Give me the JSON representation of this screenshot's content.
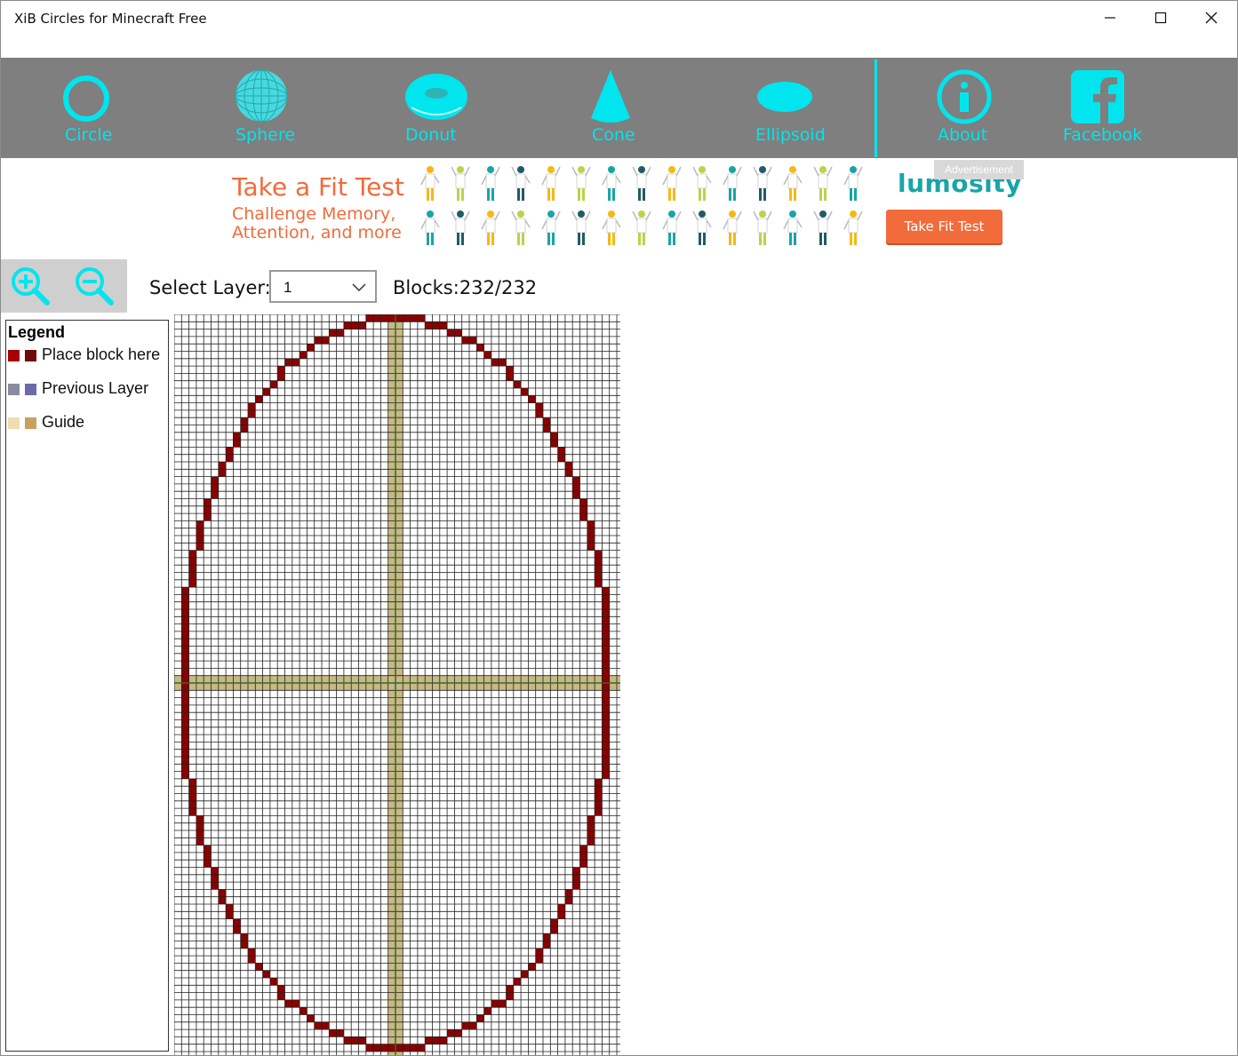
{
  "window": {
    "title": "XiB Circles for Minecraft Free",
    "controls": [
      "minimize",
      "maximize",
      "close"
    ]
  },
  "toolbar": {
    "background": "#7f7f7f",
    "accent": "#00e5ee",
    "items": [
      {
        "label": "Circle",
        "icon": "circle-icon"
      },
      {
        "label": "Sphere",
        "icon": "sphere-icon"
      },
      {
        "label": "Donut",
        "icon": "donut-icon"
      },
      {
        "label": "Cone",
        "icon": "cone-icon"
      },
      {
        "label": "Ellipsoid",
        "icon": "ellipsoid-icon"
      },
      {
        "label": "About",
        "icon": "info-icon"
      },
      {
        "label": "Facebook",
        "icon": "facebook-icon"
      }
    ]
  },
  "ad": {
    "tag": "Advertisement",
    "headline": "Take a Fit Test",
    "subline": "Challenge Memory, Attention, and more",
    "brand": "lumosity",
    "cta": "Take Fit Test"
  },
  "controls": {
    "zoom_in": "zoom-in-icon",
    "zoom_out": "zoom-out-icon",
    "layer_label": "Select Layer:",
    "layer_value": "1",
    "blocks": "Blocks:232/232"
  },
  "legend": {
    "title": "Legend",
    "items": [
      {
        "label": "Place block here",
        "colors": [
          "#a80000",
          "#6e0a0a"
        ]
      },
      {
        "label": "Previous Layer",
        "colors": [
          "#8a8aa0",
          "#6b6ba8"
        ]
      },
      {
        "label": "Guide",
        "colors": [
          "#f2dcb0",
          "#c8a060"
        ]
      }
    ]
  },
  "grid": {
    "shape": "ellipse",
    "block_color": "#8b0000",
    "guide_color": "#c8b882",
    "center_line_color": "#2e6b2e"
  }
}
